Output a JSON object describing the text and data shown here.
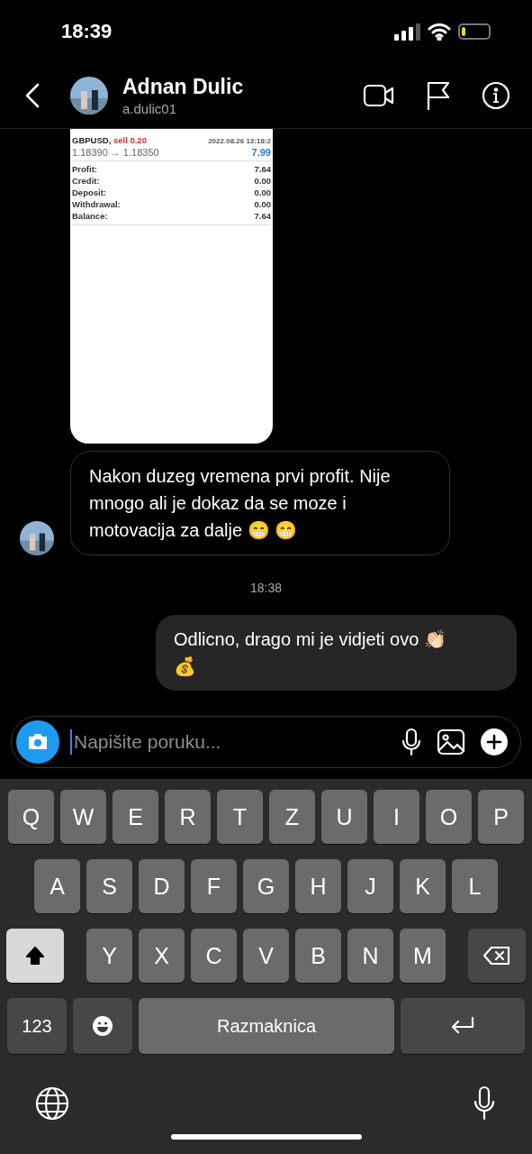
{
  "status_bar": {
    "time": "18:39"
  },
  "header": {
    "name": "Adnan Dulic",
    "username": "a.dulic01"
  },
  "shared_screenshot": {
    "symbol": "GBPUSD,",
    "side": "sell 0.20",
    "datetime": "2022.08.26 13:18:2",
    "prices": "1.18390 → 1.18350",
    "result": "7.99",
    "rows": [
      {
        "label": "Profit:",
        "value": "7.64"
      },
      {
        "label": "Credit:",
        "value": "0.00"
      },
      {
        "label": "Deposit:",
        "value": "0.00"
      },
      {
        "label": "Withdrawal:",
        "value": "0.00"
      },
      {
        "label": "Balance:",
        "value": "7.64"
      }
    ]
  },
  "messages": [
    {
      "kind": "incoming",
      "text": "Nakon duzeg vremena prvi profit. Nije mnogo ali je dokaz da se moze i motovacija za dalje 😁 😁"
    },
    {
      "kind": "time",
      "text": "18:38"
    },
    {
      "kind": "outgoing",
      "text": "Odlicno, drago mi je vidjeti ovo 👏🏻 💰"
    }
  ],
  "composer": {
    "placeholder": "Napišite poruku..."
  },
  "keyboard": {
    "rows": [
      [
        "Q",
        "W",
        "E",
        "R",
        "T",
        "Z",
        "U",
        "I",
        "O",
        "P"
      ],
      [
        "A",
        "S",
        "D",
        "F",
        "G",
        "H",
        "J",
        "K",
        "L"
      ],
      [
        "Y",
        "X",
        "C",
        "V",
        "B",
        "N",
        "M"
      ]
    ],
    "shift_on": true,
    "numbers_key": "123",
    "space_key": "Razmaknica"
  }
}
